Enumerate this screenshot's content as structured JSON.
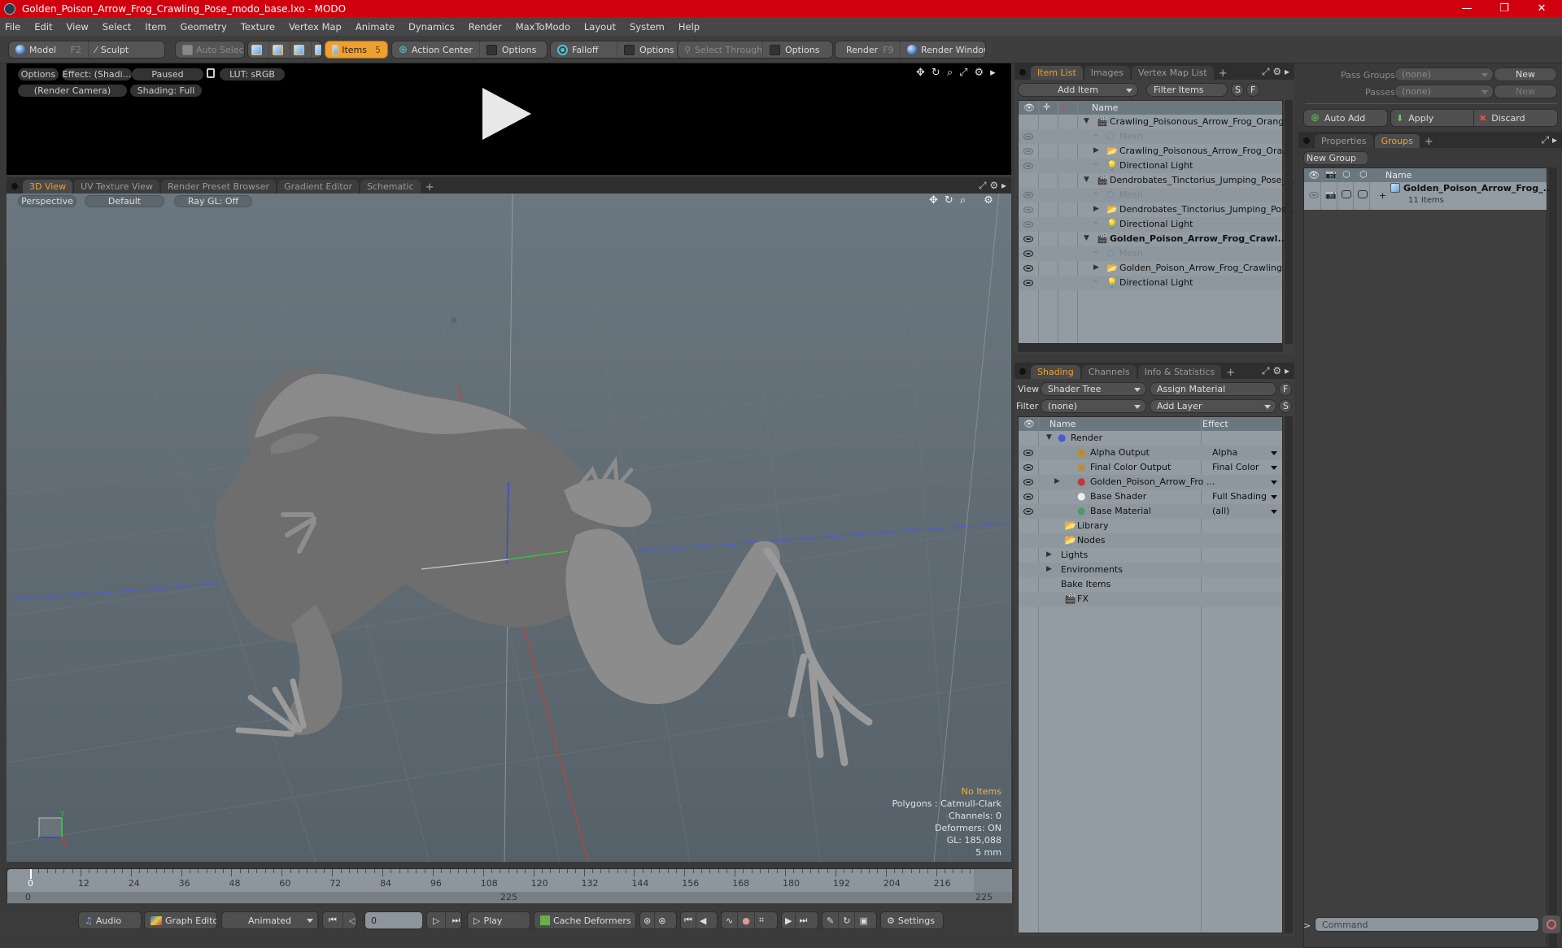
{
  "window": {
    "title": "Golden_Poison_Arrow_Frog_Crawling_Pose_modo_base.lxo - MODO",
    "controls": {
      "minimize": "—",
      "restore": "❐",
      "close": "✕"
    }
  },
  "menu": [
    "File",
    "Edit",
    "View",
    "Select",
    "Item",
    "Geometry",
    "Texture",
    "Vertex Map",
    "Animate",
    "Dynamics",
    "Render",
    "MaxToModo",
    "Layout",
    "System",
    "Help"
  ],
  "toolbar": {
    "model": "Model",
    "model_key": "F2",
    "sculpt": "Sculpt",
    "auto_select": "Auto Select",
    "items": "Items",
    "items_key": "5",
    "action_center": "Action Center",
    "options1": "Options",
    "falloff": "Falloff",
    "options2": "Options",
    "select_through": "Select Through",
    "options3": "Options",
    "render": "Render",
    "render_key": "F9",
    "render_window": "Render Window"
  },
  "preview": {
    "options": "Options",
    "effect": "Effect: (Shadi...",
    "paused": "Paused",
    "lut": "LUT: sRGB",
    "camera": "(Render Camera)",
    "shading": "Shading: Full",
    "icons": [
      "move-icon",
      "rotate-icon",
      "zoom-icon",
      "maximize-icon",
      "gear-icon",
      "arrow-right-icon"
    ]
  },
  "viewport": {
    "tabs": [
      "3D View",
      "UV Texture View",
      "Render Preset Browser",
      "Gradient Editor",
      "Schematic"
    ],
    "active_tab": 0,
    "perspective": "Perspective",
    "default": "Default",
    "raygl": "Ray GL: Off",
    "stats": {
      "items": "No Items",
      "polygons": "Polygons : Catmull-Clark",
      "channels": "Channels: 0",
      "deformers": "Deformers: ON",
      "gl": "GL: 185,088",
      "scale": "5 mm"
    },
    "colors": {
      "accent": "#f0a030",
      "x_axis": "#d03a2a",
      "y_axis": "#3ac040",
      "z_axis": "#3a4ad0"
    }
  },
  "timeline": {
    "labels": [
      "0",
      "12",
      "24",
      "36",
      "48",
      "60",
      "72",
      "84",
      "96",
      "108",
      "120",
      "132",
      "144",
      "156",
      "168",
      "180",
      "192",
      "204",
      "216"
    ],
    "range_start": "0",
    "range_end_mid": "225",
    "range_end": "225",
    "current_frame_label": "0"
  },
  "bottombar": {
    "audio": "Audio",
    "graph_editor": "Graph Editor",
    "animated": "Animated",
    "frame": "0",
    "play": "Play",
    "cache_deformers": "Cache Deformers",
    "settings": "Settings"
  },
  "itemlist": {
    "tabs": [
      "Item List",
      "Images",
      "Vertex Map List"
    ],
    "add_item": "Add Item",
    "filter": "Filter Items",
    "s": "S",
    "f": "F",
    "name_header": "Name",
    "rows": [
      {
        "label": "Crawling_Poisonous_Arrow_Frog_Orang...",
        "type": "scene",
        "level": 0,
        "expand": "down",
        "eye": "none",
        "style": "normal"
      },
      {
        "label": "Mesh",
        "type": "mesh",
        "level": 1,
        "expand": "none",
        "eye": "dim",
        "style": "gray"
      },
      {
        "label": "Crawling_Poisonous_Arrow_Frog_Ora...",
        "type": "folder",
        "level": 1,
        "expand": "right",
        "eye": "dim",
        "style": "normal"
      },
      {
        "label": "Directional Light",
        "type": "light",
        "level": 1,
        "expand": "none",
        "eye": "dim",
        "style": "normal"
      },
      {
        "label": "Dendrobates_Tinctorius_Jumping_Pose_...",
        "type": "scene",
        "level": 0,
        "expand": "down",
        "eye": "none",
        "style": "normal"
      },
      {
        "label": "Mesh",
        "type": "mesh",
        "level": 1,
        "expand": "none",
        "eye": "dim",
        "style": "gray"
      },
      {
        "label": "Dendrobates_Tinctorius_Jumping_Pos...",
        "type": "folder",
        "level": 1,
        "expand": "right",
        "eye": "dim",
        "style": "normal"
      },
      {
        "label": "Directional Light",
        "type": "light",
        "level": 1,
        "expand": "none",
        "eye": "dim",
        "style": "normal"
      },
      {
        "label": "Golden_Poison_Arrow_Frog_Crawl...",
        "type": "scene",
        "level": 0,
        "expand": "down",
        "eye": "on",
        "style": "bold"
      },
      {
        "label": "Mesh",
        "type": "mesh",
        "level": 1,
        "expand": "none",
        "eye": "on",
        "style": "gray"
      },
      {
        "label": "Golden_Poison_Arrow_Frog_Crawling ...",
        "type": "folder",
        "level": 1,
        "expand": "right",
        "eye": "on",
        "style": "normal"
      },
      {
        "label": "Directional Light",
        "type": "light",
        "level": 1,
        "expand": "none",
        "eye": "on",
        "style": "normal"
      }
    ]
  },
  "shading": {
    "tabs": [
      "Shading",
      "Channels",
      "Info & Statistics"
    ],
    "view_label": "View",
    "view_value": "Shader Tree",
    "assign_material": "Assign Material",
    "f": "F",
    "filter_label": "Filter",
    "filter_value": "(none)",
    "add_layer": "Add Layer",
    "s": "S",
    "name_header": "Name",
    "effect_header": "Effect",
    "rows": [
      {
        "label": "Render",
        "icon": "render",
        "level": 0,
        "expand": "down",
        "eye": false,
        "effect": "",
        "dd": false
      },
      {
        "label": "Alpha Output",
        "icon": "output",
        "level": 1,
        "expand": "none",
        "eye": true,
        "effect": "Alpha",
        "dd": true
      },
      {
        "label": "Final Color Output",
        "icon": "output",
        "level": 1,
        "expand": "none",
        "eye": true,
        "effect": "Final Color",
        "dd": true
      },
      {
        "label": "Golden_Poison_Arrow_Fro ...",
        "icon": "material-group",
        "level": 1,
        "expand": "right",
        "eye": true,
        "effect": "",
        "dd": true
      },
      {
        "label": "Base Shader",
        "icon": "shader",
        "level": 1,
        "expand": "none",
        "eye": true,
        "effect": "Full Shading",
        "dd": true
      },
      {
        "label": "Base Material",
        "icon": "material",
        "level": 1,
        "expand": "none",
        "eye": true,
        "effect": "(all)",
        "dd": true
      },
      {
        "label": "Library",
        "icon": "folder",
        "level": 2,
        "expand": "none",
        "eye": false,
        "effect": "",
        "dd": false
      },
      {
        "label": "Nodes",
        "icon": "folder",
        "level": 2,
        "expand": "none",
        "eye": false,
        "effect": "",
        "dd": false
      },
      {
        "label": "Lights",
        "icon": "none",
        "level": 0,
        "expand": "right",
        "eye": false,
        "effect": "",
        "dd": false
      },
      {
        "label": "Environments",
        "icon": "none",
        "level": 0,
        "expand": "right",
        "eye": false,
        "effect": "",
        "dd": false
      },
      {
        "label": "Bake Items",
        "icon": "none",
        "level": 0,
        "expand": "none",
        "eye": false,
        "effect": "",
        "dd": false
      },
      {
        "label": "FX",
        "icon": "clapper",
        "level": 2,
        "expand": "none",
        "eye": false,
        "effect": "",
        "dd": false
      }
    ]
  },
  "passes": {
    "pass_groups_label": "Pass Groups",
    "pass_groups_value": "(none)",
    "new1": "New",
    "passes_label": "Passes",
    "passes_value": "(none)",
    "new2": "New",
    "auto_add": "Auto Add",
    "apply": "Apply",
    "discard": "Discard"
  },
  "groups": {
    "tabs": [
      "Properties",
      "Groups"
    ],
    "active_tab": 1,
    "new_group": "New Group",
    "name_header": "Name",
    "group_name": "Golden_Poison_Arrow_Frog_...",
    "group_count": "11 Items"
  },
  "command": {
    "prompt": ">",
    "placeholder": "Command"
  }
}
